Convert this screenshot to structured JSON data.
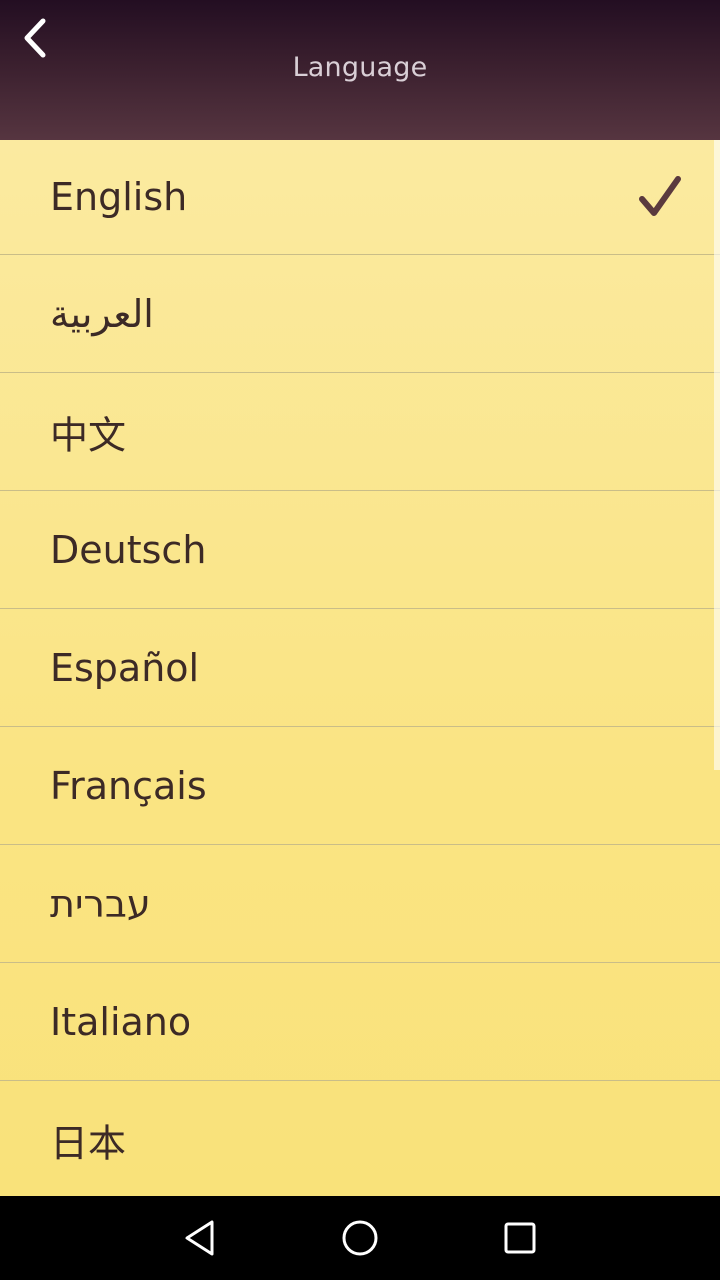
{
  "header": {
    "title": "Language",
    "back_icon": "chevron-left-icon"
  },
  "languages": [
    {
      "label": "English",
      "selected": true
    },
    {
      "label": "العربية",
      "selected": false
    },
    {
      "label": "中文",
      "selected": false
    },
    {
      "label": "Deutsch",
      "selected": false
    },
    {
      "label": "Español",
      "selected": false
    },
    {
      "label": "Français",
      "selected": false
    },
    {
      "label": "עברית",
      "selected": false
    },
    {
      "label": "Italiano",
      "selected": false
    },
    {
      "label": "日本",
      "selected": false
    }
  ],
  "navbar": {
    "icons": [
      "back-triangle-icon",
      "home-circle-icon",
      "recents-square-icon"
    ]
  },
  "colors": {
    "header_top": "#230e22",
    "header_bottom": "#563540",
    "list_background": "#f9e37a",
    "text": "#3c2a26",
    "check": "#5a3a3e",
    "navbar": "#000000"
  }
}
